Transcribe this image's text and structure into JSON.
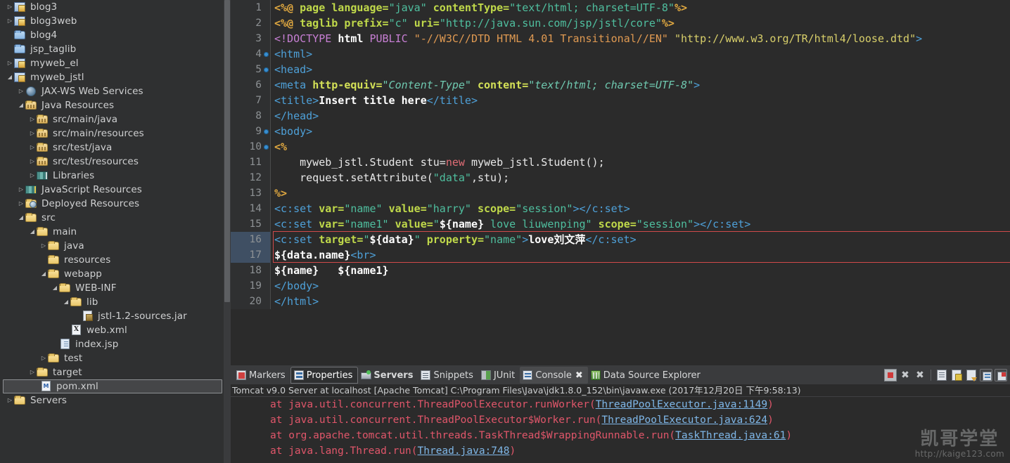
{
  "sidebar": {
    "tree": [
      {
        "label": "blog3",
        "depth": 0,
        "twisty": "collapsed",
        "icon": "project-icon"
      },
      {
        "label": "blog3web",
        "depth": 0,
        "twisty": "collapsed",
        "icon": "project-icon"
      },
      {
        "label": "blog4",
        "depth": 0,
        "twisty": "none",
        "icon": "folder-blue-icon"
      },
      {
        "label": "jsp_taglib",
        "depth": 0,
        "twisty": "none",
        "icon": "folder-blue-icon"
      },
      {
        "label": "myweb_el",
        "depth": 0,
        "twisty": "collapsed",
        "icon": "project-icon"
      },
      {
        "label": "myweb_jstl",
        "depth": 0,
        "twisty": "expanded",
        "icon": "project-icon"
      },
      {
        "label": "JAX-WS Web Services",
        "depth": 1,
        "twisty": "collapsed",
        "icon": "globe-icon"
      },
      {
        "label": "Java Resources",
        "depth": 1,
        "twisty": "expanded",
        "icon": "source-folder-icon"
      },
      {
        "label": "src/main/java",
        "depth": 2,
        "twisty": "collapsed",
        "icon": "source-folder-icon"
      },
      {
        "label": "src/main/resources",
        "depth": 2,
        "twisty": "collapsed",
        "icon": "source-folder-icon"
      },
      {
        "label": "src/test/java",
        "depth": 2,
        "twisty": "collapsed",
        "icon": "source-folder-icon"
      },
      {
        "label": "src/test/resources",
        "depth": 2,
        "twisty": "collapsed",
        "icon": "source-folder-icon"
      },
      {
        "label": "Libraries",
        "depth": 2,
        "twisty": "collapsed",
        "icon": "books-icon"
      },
      {
        "label": "JavaScript Resources",
        "depth": 1,
        "twisty": "collapsed",
        "icon": "books-js-icon"
      },
      {
        "label": "Deployed Resources",
        "depth": 1,
        "twisty": "collapsed",
        "icon": "deployed-folder-icon"
      },
      {
        "label": "src",
        "depth": 1,
        "twisty": "expanded",
        "icon": "folder-open-icon"
      },
      {
        "label": "main",
        "depth": 2,
        "twisty": "expanded",
        "icon": "folder-open-icon"
      },
      {
        "label": "java",
        "depth": 3,
        "twisty": "collapsed",
        "icon": "folder-icon"
      },
      {
        "label": "resources",
        "depth": 3,
        "twisty": "none",
        "icon": "folder-icon"
      },
      {
        "label": "webapp",
        "depth": 3,
        "twisty": "expanded",
        "icon": "folder-open-icon"
      },
      {
        "label": "WEB-INF",
        "depth": 4,
        "twisty": "expanded",
        "icon": "folder-open-icon"
      },
      {
        "label": "lib",
        "depth": 5,
        "twisty": "expanded",
        "icon": "folder-open-icon"
      },
      {
        "label": "jstl-1.2-sources.jar",
        "depth": 6,
        "twisty": "none",
        "icon": "jar-file-icon"
      },
      {
        "label": "web.xml",
        "depth": 5,
        "twisty": "none",
        "icon": "xml-file-icon"
      },
      {
        "label": "index.jsp",
        "depth": 4,
        "twisty": "none",
        "icon": "jsp-file-icon"
      },
      {
        "label": "test",
        "depth": 3,
        "twisty": "collapsed",
        "icon": "folder-icon"
      },
      {
        "label": "target",
        "depth": 2,
        "twisty": "collapsed",
        "icon": "folder-icon"
      },
      {
        "label": "pom.xml",
        "depth": 2,
        "twisty": "none",
        "icon": "maven-file-icon",
        "selected": true
      },
      {
        "label": "Servers",
        "depth": 0,
        "twisty": "collapsed",
        "icon": "folder-open-icon"
      }
    ]
  },
  "editor": {
    "lines": [
      {
        "num": "1",
        "fold": false,
        "tokens": [
          {
            "t": "<%@",
            "c": "t-dir"
          },
          {
            "t": " ",
            "c": "t-plain"
          },
          {
            "t": "page",
            "c": "t-attr"
          },
          {
            "t": " ",
            "c": "t-plain"
          },
          {
            "t": "language=",
            "c": "t-attr"
          },
          {
            "t": "\"java\"",
            "c": "t-str"
          },
          {
            "t": " ",
            "c": "t-plain"
          },
          {
            "t": "contentType=",
            "c": "t-attr"
          },
          {
            "t": "\"text/html; charset=UTF-8\"",
            "c": "t-str"
          },
          {
            "t": "%>",
            "c": "t-dir"
          }
        ]
      },
      {
        "num": "2",
        "fold": false,
        "tokens": [
          {
            "t": "<%@",
            "c": "t-dir"
          },
          {
            "t": " ",
            "c": "t-plain"
          },
          {
            "t": "taglib",
            "c": "t-attr"
          },
          {
            "t": " ",
            "c": "t-plain"
          },
          {
            "t": "prefix=",
            "c": "t-attr"
          },
          {
            "t": "\"c\"",
            "c": "t-str"
          },
          {
            "t": " ",
            "c": "t-plain"
          },
          {
            "t": "uri=",
            "c": "t-attr"
          },
          {
            "t": "\"http://java.sun.com/jsp/jstl/core\"",
            "c": "t-str"
          },
          {
            "t": "%>",
            "c": "t-dir"
          }
        ]
      },
      {
        "num": "3",
        "fold": false,
        "tokens": [
          {
            "t": "<!DOCTYPE",
            "c": "t-doctype"
          },
          {
            "t": " ",
            "c": "t-plain"
          },
          {
            "t": "html",
            "c": "t-el"
          },
          {
            "t": " ",
            "c": "t-plain"
          },
          {
            "t": "PUBLIC",
            "c": "t-doctype"
          },
          {
            "t": " ",
            "c": "t-plain"
          },
          {
            "t": "\"-//W3C//DTD HTML 4.01 Transitional//EN\"",
            "c": "t-doctype2"
          },
          {
            "t": " ",
            "c": "t-plain"
          },
          {
            "t": "\"http://www.w3.org/TR/html4/loose.dtd\"",
            "c": "t-str-y"
          },
          {
            "t": ">",
            "c": "t-tag"
          }
        ]
      },
      {
        "num": "4",
        "fold": true,
        "tokens": [
          {
            "t": "<html>",
            "c": "t-tag"
          }
        ]
      },
      {
        "num": "5",
        "fold": true,
        "tokens": [
          {
            "t": "<head>",
            "c": "t-tag"
          }
        ]
      },
      {
        "num": "6",
        "fold": false,
        "tokens": [
          {
            "t": "<meta",
            "c": "t-tag"
          },
          {
            "t": " ",
            "c": "t-plain"
          },
          {
            "t": "http-equiv=",
            "c": "t-attr-b"
          },
          {
            "t": "\"Content-Type\"",
            "c": "t-str-i"
          },
          {
            "t": " ",
            "c": "t-plain"
          },
          {
            "t": "content=",
            "c": "t-attr-b"
          },
          {
            "t": "\"text/html; charset=UTF-8\"",
            "c": "t-str-i"
          },
          {
            "t": ">",
            "c": "t-tag"
          }
        ]
      },
      {
        "num": "7",
        "fold": false,
        "tokens": [
          {
            "t": "<title>",
            "c": "t-tag"
          },
          {
            "t": "Insert title here",
            "c": "t-el"
          },
          {
            "t": "</title>",
            "c": "t-tag"
          }
        ]
      },
      {
        "num": "8",
        "fold": false,
        "tokens": [
          {
            "t": "</head>",
            "c": "t-tag"
          }
        ]
      },
      {
        "num": "9",
        "fold": true,
        "tokens": [
          {
            "t": "<body>",
            "c": "t-tag"
          }
        ]
      },
      {
        "num": "10",
        "fold": true,
        "tokens": [
          {
            "t": "<%",
            "c": "t-dir"
          }
        ]
      },
      {
        "num": "11",
        "fold": false,
        "tokens": [
          {
            "t": "    myweb_jstl.Student stu=",
            "c": "t-plain"
          },
          {
            "t": "new",
            "c": "t-kw"
          },
          {
            "t": " myweb_jstl.Student();",
            "c": "t-plain"
          }
        ]
      },
      {
        "num": "12",
        "fold": false,
        "tokens": [
          {
            "t": "    request.setAttribute(",
            "c": "t-plain"
          },
          {
            "t": "\"data\"",
            "c": "t-str"
          },
          {
            "t": ",stu);",
            "c": "t-plain"
          }
        ]
      },
      {
        "num": "13",
        "fold": false,
        "tokens": [
          {
            "t": "%>",
            "c": "t-dir"
          }
        ]
      },
      {
        "num": "14",
        "fold": false,
        "tokens": [
          {
            "t": "<c:set",
            "c": "t-tag"
          },
          {
            "t": " ",
            "c": "t-plain"
          },
          {
            "t": "var=",
            "c": "t-attr"
          },
          {
            "t": "\"name\"",
            "c": "t-str"
          },
          {
            "t": " ",
            "c": "t-plain"
          },
          {
            "t": "value=",
            "c": "t-attr"
          },
          {
            "t": "\"harry\"",
            "c": "t-str"
          },
          {
            "t": " ",
            "c": "t-plain"
          },
          {
            "t": "scope=",
            "c": "t-attr"
          },
          {
            "t": "\"session\"",
            "c": "t-str"
          },
          {
            "t": ">",
            "c": "t-tag"
          },
          {
            "t": "</c:set>",
            "c": "t-tag"
          }
        ]
      },
      {
        "num": "15",
        "fold": false,
        "tokens": [
          {
            "t": "<c:set",
            "c": "t-tag"
          },
          {
            "t": " ",
            "c": "t-plain"
          },
          {
            "t": "var=",
            "c": "t-attr"
          },
          {
            "t": "\"name1\"",
            "c": "t-str"
          },
          {
            "t": " ",
            "c": "t-plain"
          },
          {
            "t": "value=",
            "c": "t-attr"
          },
          {
            "t": "\"",
            "c": "t-str"
          },
          {
            "t": "${name}",
            "c": "t-el"
          },
          {
            "t": " love liuwenping\"",
            "c": "t-str"
          },
          {
            "t": " ",
            "c": "t-plain"
          },
          {
            "t": "scope=",
            "c": "t-attr"
          },
          {
            "t": "\"session\"",
            "c": "t-str"
          },
          {
            "t": ">",
            "c": "t-tag"
          },
          {
            "t": "</c:set>",
            "c": "t-tag"
          }
        ]
      },
      {
        "num": "16",
        "fold": false,
        "marked": true,
        "tokens": [
          {
            "t": "<c:set",
            "c": "t-tag"
          },
          {
            "t": " ",
            "c": "t-plain"
          },
          {
            "t": "target=",
            "c": "t-attr"
          },
          {
            "t": "\"",
            "c": "t-str"
          },
          {
            "t": "${data}",
            "c": "t-el"
          },
          {
            "t": "\"",
            "c": "t-str"
          },
          {
            "t": " ",
            "c": "t-plain"
          },
          {
            "t": "property=",
            "c": "t-attr"
          },
          {
            "t": "\"name\"",
            "c": "t-str"
          },
          {
            "t": ">",
            "c": "t-tag"
          },
          {
            "t": "love刘文萍",
            "c": "t-el"
          },
          {
            "t": "</c:set>",
            "c": "t-tag"
          }
        ]
      },
      {
        "num": "17",
        "fold": false,
        "marked": true,
        "tokens": [
          {
            "t": "${data.name}",
            "c": "t-el"
          },
          {
            "t": "<br>",
            "c": "t-tag"
          }
        ]
      },
      {
        "num": "18",
        "fold": false,
        "tokens": [
          {
            "t": "${name}   ${name1}",
            "c": "t-el"
          }
        ]
      },
      {
        "num": "19",
        "fold": false,
        "tokens": [
          {
            "t": "</body>",
            "c": "t-tag"
          }
        ]
      },
      {
        "num": "20",
        "fold": false,
        "tokens": [
          {
            "t": "</html>",
            "c": "t-tag"
          }
        ]
      }
    ]
  },
  "bottom_panel": {
    "tabs": [
      {
        "label": "Markers",
        "icon": "markers-icon",
        "state": "normal"
      },
      {
        "label": "Properties",
        "icon": "properties-icon",
        "state": "active"
      },
      {
        "label": "Servers",
        "icon": "servers-icon",
        "state": "bold"
      },
      {
        "label": "Snippets",
        "icon": "snippets-icon",
        "state": "normal"
      },
      {
        "label": "JUnit",
        "icon": "junit-icon",
        "state": "normal"
      },
      {
        "label": "Console",
        "icon": "console-icon",
        "state": "selected",
        "close": "✖"
      },
      {
        "label": "Data Source Explorer",
        "icon": "data-source-explorer-icon",
        "state": "normal"
      }
    ],
    "toolbar": [
      {
        "name": "terminate-button",
        "icon": "stop-icon"
      },
      {
        "name": "remove-launch-button",
        "icon": "close-x-icon"
      },
      {
        "name": "remove-all-terminated-button",
        "icon": "close-all-x-icon"
      },
      {
        "name": "clear-console-button",
        "icon": "clear-document-icon"
      },
      {
        "name": "scroll-lock-button",
        "icon": "lock-document-icon"
      },
      {
        "name": "word-wrap-button",
        "icon": "document-wrap-icon"
      },
      {
        "name": "pin-console-button",
        "icon": "pin-console-icon"
      },
      {
        "name": "display-selected-console-button",
        "icon": "select-console-icon"
      }
    ],
    "console_header": "Tomcat v9.0 Server at localhost [Apache Tomcat] C:\\Program Files\\Java\\jdk1.8.0_152\\bin\\javaw.exe (2017年12月20日 下午9:58:13)",
    "stack_trace": [
      {
        "prefix": "at java.util.concurrent.ThreadPoolExecutor.runWorker(",
        "link": "ThreadPoolExecutor.java:1149",
        "suffix": ")"
      },
      {
        "prefix": "at java.util.concurrent.ThreadPoolExecutor$Worker.run(",
        "link": "ThreadPoolExecutor.java:624",
        "suffix": ")"
      },
      {
        "prefix": "at org.apache.tomcat.util.threads.TaskThread$WrappingRunnable.run(",
        "link": "TaskThread.java:61",
        "suffix": ")"
      },
      {
        "prefix": "at java.lang.Thread.run(",
        "link": "Thread.java:748",
        "suffix": ")"
      }
    ]
  },
  "watermark": {
    "title": "凯哥学堂",
    "url": "http://kaige123.com"
  },
  "colors": {
    "editor_bg": "#2b2b2b",
    "sidebar_bg": "#2f3031",
    "gutter_bg": "#2f3031",
    "marker_highlight": "#3f4f63",
    "red_box_border": "#d04a4a",
    "tag_blue": "#4ea0d8",
    "attr_yellow": "#c0d94a",
    "string_green": "#4fbf9f",
    "directive_orange": "#e0a840",
    "error_red": "#e0566a",
    "link_blue": "#7fb7e8"
  }
}
